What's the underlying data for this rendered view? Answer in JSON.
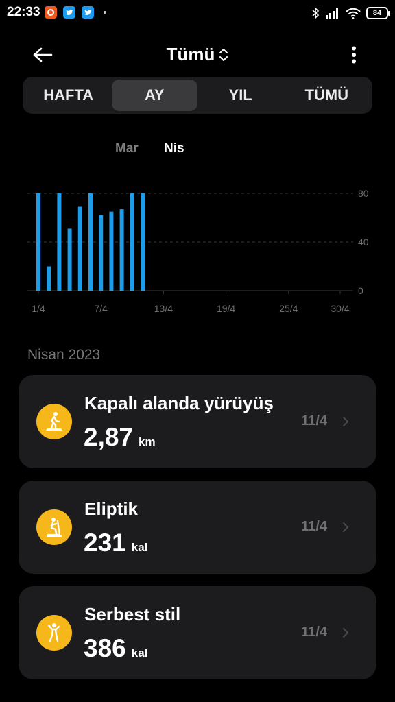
{
  "status_bar": {
    "time": "22:33",
    "battery": "84",
    "notification_icons": [
      "app-notification-icon",
      "twitter-icon",
      "twitter-icon"
    ],
    "system_icons": [
      "bluetooth-icon",
      "signal-icon",
      "wifi-icon",
      "battery-icon"
    ]
  },
  "header": {
    "title": "Tümü",
    "back_icon": "arrow-left-icon",
    "dropdown_icon": "chevron-updown-icon",
    "more_icon": "more-vertical-icon"
  },
  "tabs": [
    {
      "label": "HAFTA",
      "active": false
    },
    {
      "label": "AY",
      "active": true
    },
    {
      "label": "YIL",
      "active": false
    },
    {
      "label": "TÜMÜ",
      "active": false
    }
  ],
  "months": {
    "previous": "Mar",
    "current": "Nis"
  },
  "chart_data": {
    "type": "bar",
    "bar_color": "#1e9be9",
    "x_tick_labels": [
      "1/4",
      "7/4",
      "13/4",
      "19/4",
      "25/4",
      "30/4"
    ],
    "y_tick_labels": [
      "0",
      "40",
      "80"
    ],
    "ylim": [
      0,
      80
    ],
    "x": [
      1,
      2,
      3,
      4,
      5,
      6,
      7,
      8,
      9,
      10,
      11
    ],
    "values": [
      80,
      20,
      80,
      51,
      69,
      80,
      62,
      65,
      67,
      80,
      80
    ],
    "grid": true
  },
  "section_title": "Nisan 2023",
  "activities": [
    {
      "icon": "walking-icon",
      "name": "Kapalı alanda yürüyüş",
      "value": "2,87",
      "unit": "km",
      "date": "11/4"
    },
    {
      "icon": "elliptical-icon",
      "name": "Eliptik",
      "value": "231",
      "unit": "kal",
      "date": "11/4"
    },
    {
      "icon": "freestyle-icon",
      "name": "Serbest stil",
      "value": "386",
      "unit": "kal",
      "date": "11/4"
    }
  ],
  "colors": {
    "background": "#000000",
    "card": "#1c1c1e",
    "accent_icon": "#f6b71a",
    "bar": "#1e9be9"
  }
}
